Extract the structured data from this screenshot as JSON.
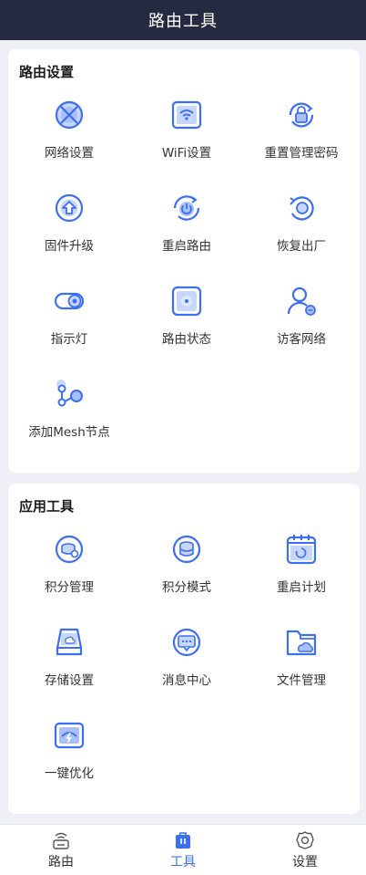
{
  "header": {
    "title": "路由工具"
  },
  "router_settings": {
    "title": "路由设置",
    "items": [
      {
        "label": "网络设置",
        "icon": "network-globe-icon"
      },
      {
        "label": "WiFi设置",
        "icon": "wifi-icon"
      },
      {
        "label": "重置管理密码",
        "icon": "lock-reset-icon"
      },
      {
        "label": "固件升级",
        "icon": "firmware-upgrade-icon"
      },
      {
        "label": "重启路由",
        "icon": "restart-power-icon"
      },
      {
        "label": "恢复出厂",
        "icon": "factory-reset-icon"
      },
      {
        "label": "指示灯",
        "icon": "indicator-toggle-icon"
      },
      {
        "label": "路由状态",
        "icon": "router-status-icon"
      },
      {
        "label": "访客网络",
        "icon": "guest-user-icon"
      },
      {
        "label": "添加Mesh节点",
        "icon": "mesh-node-icon"
      }
    ]
  },
  "app_tools": {
    "title": "应用工具",
    "items": [
      {
        "label": "积分管理",
        "icon": "points-manage-icon"
      },
      {
        "label": "积分模式",
        "icon": "points-mode-icon"
      },
      {
        "label": "重启计划",
        "icon": "restart-schedule-icon"
      },
      {
        "label": "存储设置",
        "icon": "storage-icon"
      },
      {
        "label": "消息中心",
        "icon": "message-icon"
      },
      {
        "label": "文件管理",
        "icon": "file-folder-icon"
      },
      {
        "label": "一键优化",
        "icon": "optimize-icon"
      }
    ]
  },
  "tabbar": {
    "tabs": [
      {
        "label": "路由",
        "icon": "router-icon",
        "active": false
      },
      {
        "label": "工具",
        "icon": "toolbox-icon",
        "active": true
      },
      {
        "label": "设置",
        "icon": "gear-icon",
        "active": false
      }
    ]
  },
  "colors": {
    "accent": "#3d6ff5",
    "header_bg": "#262a40",
    "page_bg": "#eef0f5"
  }
}
